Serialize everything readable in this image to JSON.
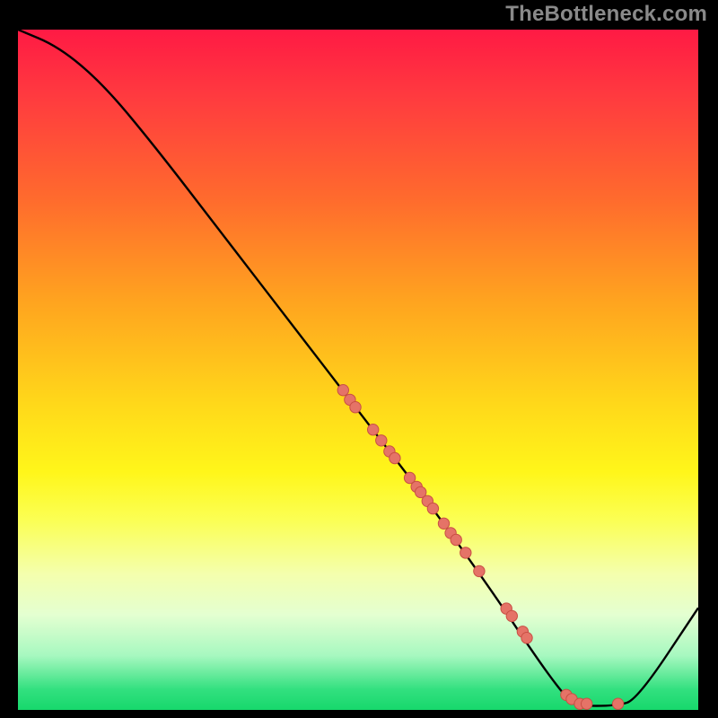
{
  "watermark": "TheBottleneck.com",
  "chart_data": {
    "type": "line",
    "title": "",
    "xlabel": "",
    "ylabel": "",
    "xlim": [
      0,
      100
    ],
    "ylim": [
      0,
      100
    ],
    "grid": false,
    "curve": [
      {
        "x": 0,
        "y": 100
      },
      {
        "x": 6,
        "y": 97.5
      },
      {
        "x": 12.5,
        "y": 92
      },
      {
        "x": 20,
        "y": 83
      },
      {
        "x": 30,
        "y": 70
      },
      {
        "x": 40,
        "y": 57
      },
      {
        "x": 50,
        "y": 44
      },
      {
        "x": 60,
        "y": 31
      },
      {
        "x": 70,
        "y": 17
      },
      {
        "x": 76,
        "y": 8
      },
      {
        "x": 80,
        "y": 2.5
      },
      {
        "x": 82,
        "y": 0.6
      },
      {
        "x": 88,
        "y": 0.6
      },
      {
        "x": 91,
        "y": 1.5
      },
      {
        "x": 100,
        "y": 15
      }
    ],
    "points": [
      {
        "x": 47.8,
        "y": 47.0
      },
      {
        "x": 48.8,
        "y": 45.6
      },
      {
        "x": 49.6,
        "y": 44.5
      },
      {
        "x": 52.2,
        "y": 41.2
      },
      {
        "x": 53.4,
        "y": 39.6
      },
      {
        "x": 54.6,
        "y": 38.0
      },
      {
        "x": 55.4,
        "y": 37.0
      },
      {
        "x": 57.6,
        "y": 34.1
      },
      {
        "x": 58.6,
        "y": 32.8
      },
      {
        "x": 59.2,
        "y": 32.0
      },
      {
        "x": 60.2,
        "y": 30.7
      },
      {
        "x": 61.0,
        "y": 29.6
      },
      {
        "x": 62.6,
        "y": 27.4
      },
      {
        "x": 63.6,
        "y": 26.0
      },
      {
        "x": 64.4,
        "y": 25.0
      },
      {
        "x": 65.8,
        "y": 23.1
      },
      {
        "x": 67.8,
        "y": 20.4
      },
      {
        "x": 71.8,
        "y": 14.9
      },
      {
        "x": 72.6,
        "y": 13.8
      },
      {
        "x": 74.2,
        "y": 11.5
      },
      {
        "x": 74.8,
        "y": 10.6
      },
      {
        "x": 80.6,
        "y": 2.2
      },
      {
        "x": 81.4,
        "y": 1.6
      },
      {
        "x": 82.6,
        "y": 0.9
      },
      {
        "x": 83.6,
        "y": 0.9
      },
      {
        "x": 88.2,
        "y": 0.9
      }
    ],
    "colors": {
      "curve": "#000000",
      "point_fill": "#e57367",
      "point_stroke": "#c94f44",
      "background_top": "#ff1a44",
      "background_bottom": "#17d86c"
    }
  }
}
